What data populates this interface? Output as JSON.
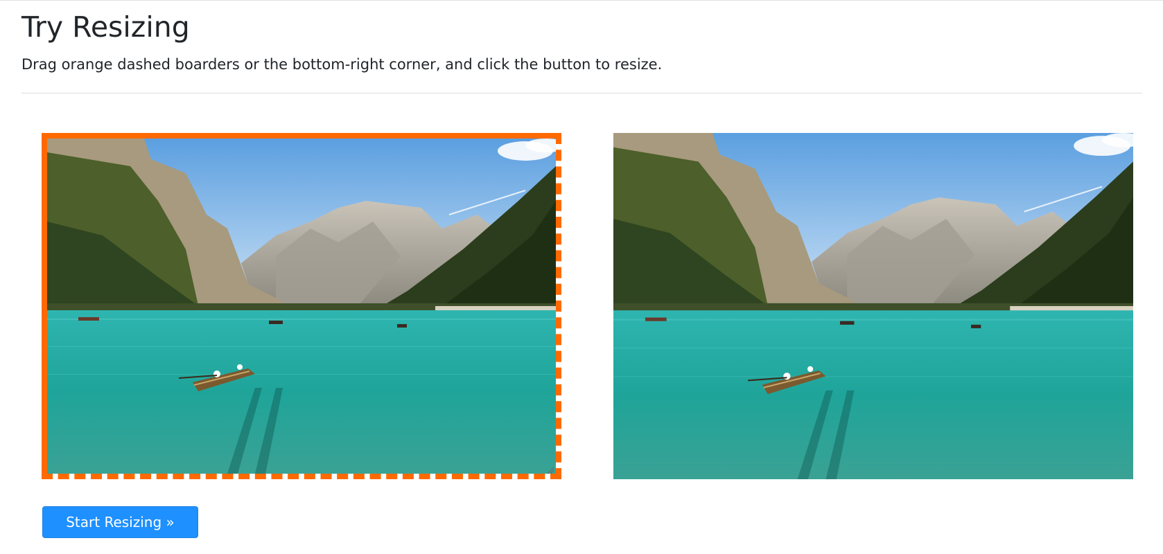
{
  "header": {
    "title": "Try Resizing",
    "subtitle": "Drag orange dashed boarders or the bottom-right corner, and click the button to resize."
  },
  "actions": {
    "start_label": "Start Resizing »"
  },
  "colors": {
    "accent_border": "#ff6a00",
    "button_primary": "#1e90ff"
  },
  "images": {
    "source": "lake-mountain-boat-photo",
    "result": "lake-mountain-boat-photo"
  }
}
